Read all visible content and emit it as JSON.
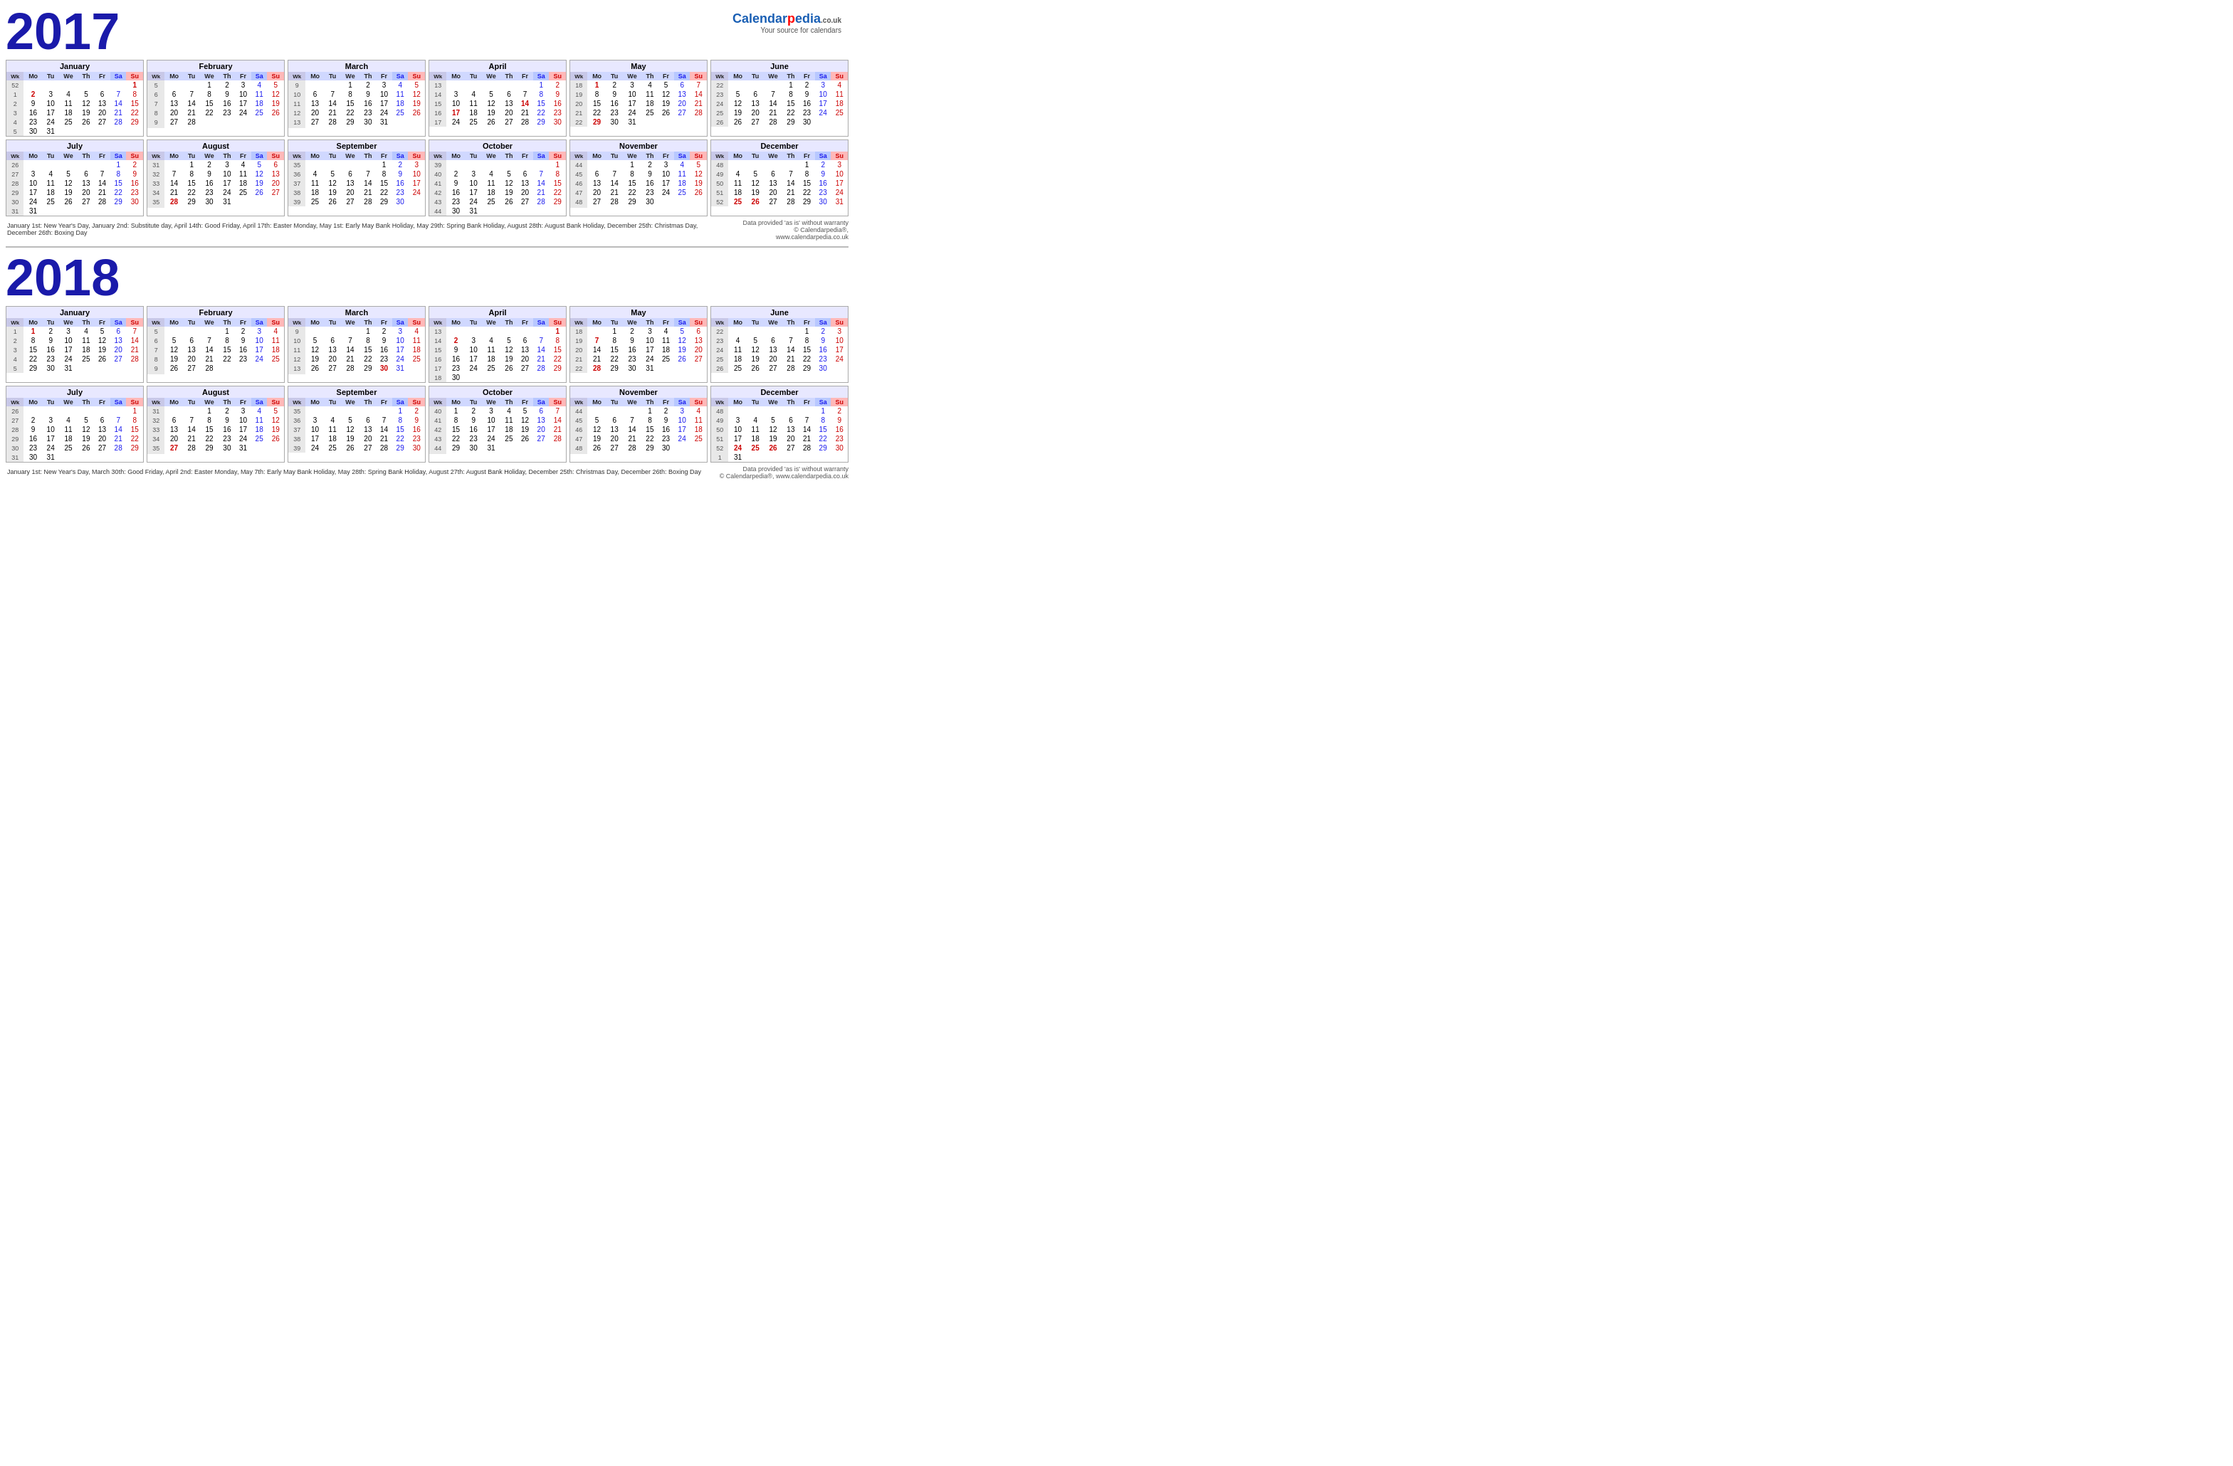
{
  "logo": {
    "brand_part1": "Calendar",
    "brand_part2": "pedia",
    "domain": ".co.uk",
    "tagline": "Your source for calendars"
  },
  "year2017": {
    "title": "2017",
    "footer_notes": "January 1st: New Year's Day, January 2nd: Substitute day, April 14th: Good Friday, April 17th: Easter Monday, May 1st: Early May Bank Holiday, May 29th: Spring Bank Holiday, August 28th: August Bank Holiday, December 25th: Christmas Day, December 26th: Boxing Day",
    "footer_right_line1": "Data provided 'as is' without warranty",
    "footer_right_line2": "© Calendarpedia®, www.calendarpedia.co.uk"
  },
  "year2018": {
    "title": "2018",
    "footer_notes": "January 1st: New Year's Day, March 30th: Good Friday, April 2nd: Easter Monday, May 7th: Early May Bank Holiday, May 28th: Spring Bank Holiday, August 27th: August Bank Holiday, December 25th: Christmas Day, December 26th: Boxing Day",
    "footer_right_line1": "Data provided 'as is' without warranty",
    "footer_right_line2": "© Calendarpedia®, www.calendarpedia.co.uk"
  }
}
